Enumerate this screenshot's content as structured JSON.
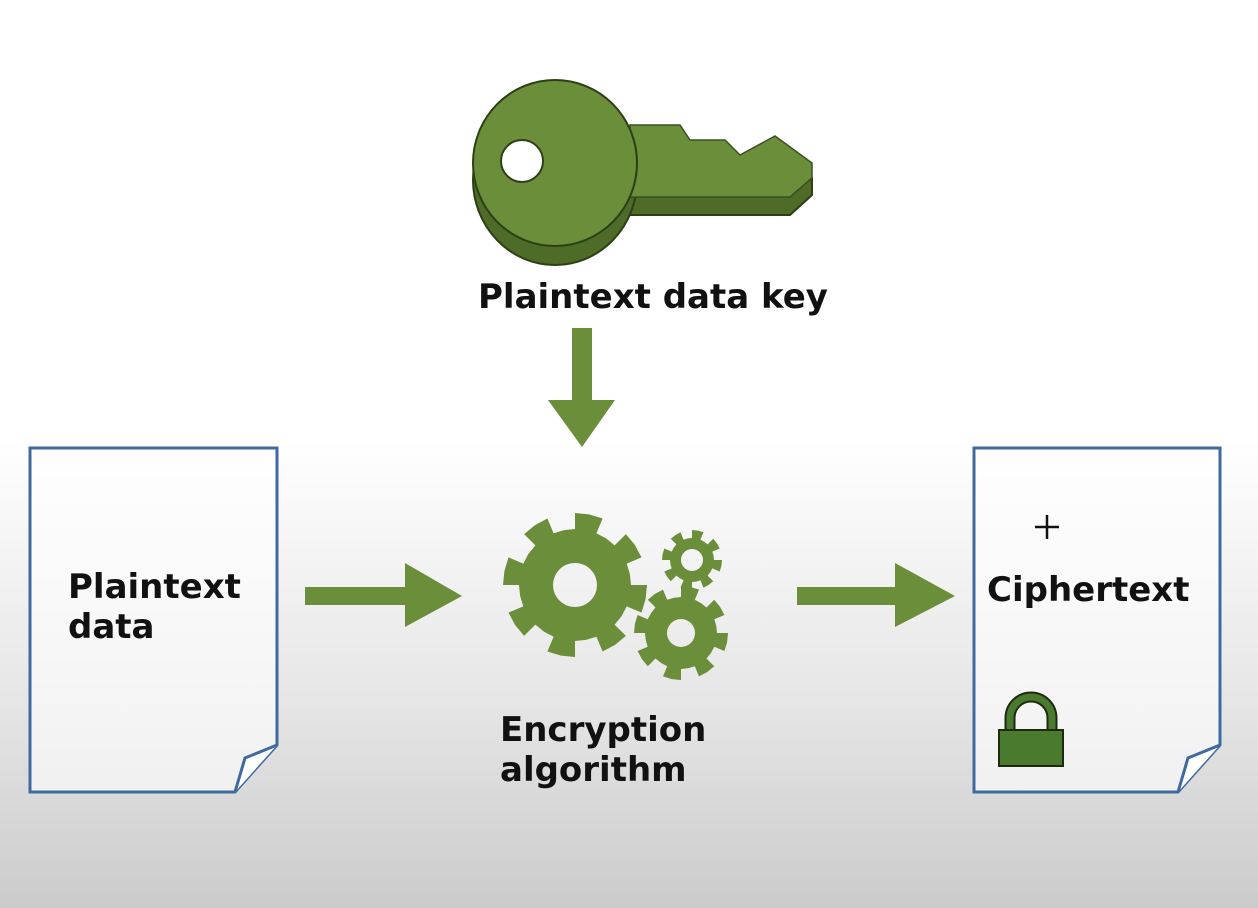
{
  "labels": {
    "key": "Plaintext data key",
    "plaintext": "Plaintext data",
    "plaintext_line1": "Plaintext",
    "plaintext_line2": "data",
    "algorithm_line1": "Encryption",
    "algorithm_line2": "algorithm",
    "ciphertext": "Ciphertext"
  },
  "icons": [
    "key-icon",
    "gears-icon",
    "lock-icon",
    "document-icon",
    "move-cursor-icon"
  ],
  "colors": {
    "green": "#6b8e3a",
    "green_dark": "#4f6b28",
    "lock": "#4a7a2e",
    "doc_border": "#3f6aa0"
  }
}
